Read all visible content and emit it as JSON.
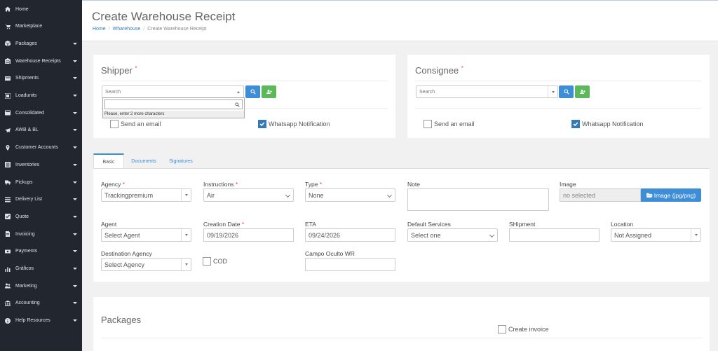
{
  "sidebar": {
    "items": [
      {
        "label": "Home",
        "icon": "home-icon",
        "caret": false
      },
      {
        "label": "Marketplace",
        "icon": "cart-icon",
        "caret": false
      },
      {
        "label": "Packages",
        "icon": "box-icon",
        "caret": true
      },
      {
        "label": "Warehouse Receipts",
        "icon": "warehouse-icon",
        "caret": true
      },
      {
        "label": "Shipments",
        "icon": "shipment-icon",
        "caret": true
      },
      {
        "label": "Loadunits",
        "icon": "loadunit-icon",
        "caret": true
      },
      {
        "label": "Consolidated",
        "icon": "consolidated-icon",
        "caret": true
      },
      {
        "label": "AWB & BL",
        "icon": "plane-icon",
        "caret": true
      },
      {
        "label": "Customer Accounts",
        "icon": "pin-icon",
        "caret": true
      },
      {
        "label": "Inventories",
        "icon": "inventory-icon",
        "caret": true
      },
      {
        "label": "Pickups",
        "icon": "truck-icon",
        "caret": true
      },
      {
        "label": "Delivery List",
        "icon": "list-icon",
        "caret": true
      },
      {
        "label": "Quote",
        "icon": "quote-icon",
        "caret": true
      },
      {
        "label": "Invoicing",
        "icon": "invoice-icon",
        "caret": true
      },
      {
        "label": "Payments",
        "icon": "money-icon",
        "caret": true
      },
      {
        "label": "Gráficos",
        "icon": "chart-icon",
        "caret": true
      },
      {
        "label": "Marketing",
        "icon": "users-icon",
        "caret": true
      },
      {
        "label": "Accounting",
        "icon": "bank-icon",
        "caret": true
      },
      {
        "label": "Help Resources",
        "icon": "info-icon",
        "caret": true
      }
    ]
  },
  "header": {
    "title": "Create Warehouse Receipt",
    "breadcrumb": [
      "Home",
      "Wharehouse",
      "Create Warehouse Receipt"
    ]
  },
  "shipper": {
    "title": "Shipper",
    "required": "*",
    "search_placeholder": "Search",
    "dropdown_message": "Please, enter 2 more characters",
    "email_label": "Send an email",
    "whatsapp_label": "Whatsapp Notification"
  },
  "consignee": {
    "title": "Consignee",
    "required": "*",
    "search_placeholder": "Search",
    "email_label": "Send an email",
    "whatsapp_label": "Whatsapp Notification"
  },
  "tabs": [
    "Basic",
    "Documents",
    "Signatures"
  ],
  "form": {
    "agency": {
      "label": "Agency",
      "value": "Trackingpremium"
    },
    "instructions": {
      "label": "Instructions",
      "value": "Air"
    },
    "type": {
      "label": "Type",
      "value": "None"
    },
    "note": {
      "label": "Note"
    },
    "image": {
      "label": "Image",
      "value": "no selected",
      "button": "Image (jpg/png)"
    },
    "agent": {
      "label": "Agent",
      "value": "Select Agent"
    },
    "creation_date": {
      "label": "Creation Date",
      "value": "09/19/2026"
    },
    "eta": {
      "label": "ETA",
      "value": "09/24/2026"
    },
    "default_services": {
      "label": "Default Services",
      "value": "Select one"
    },
    "shipment": {
      "label": "SHipment"
    },
    "location": {
      "label": "Location",
      "value": "Not Assigned"
    },
    "destination_agency": {
      "label": "Destination Agency",
      "value": "Select Agency"
    },
    "cod": {
      "label": "COD"
    },
    "campo_oculto": {
      "label": "Campo Oculto WR"
    },
    "required": "*"
  },
  "packages": {
    "title": "Packages",
    "create_invoice_label": "Create invoice"
  },
  "colors": {
    "sidebar": "#22262e",
    "accent": "#3e8ed7",
    "success": "#5db85c",
    "required": "#e74c3c"
  }
}
